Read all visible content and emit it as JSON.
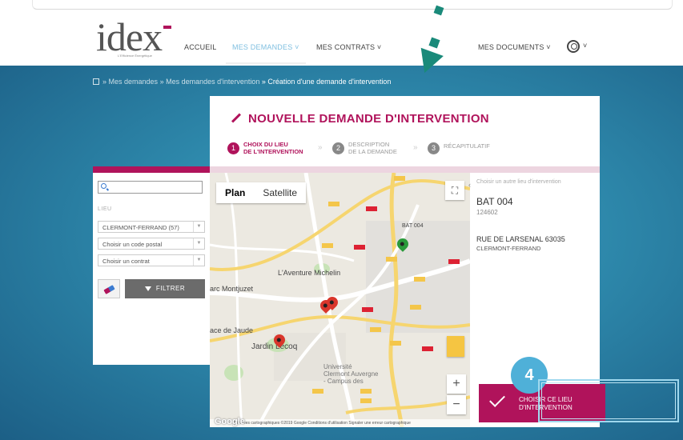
{
  "header": {
    "logo_text": "idex",
    "logo_tagline": "L'Efficience Énergétique",
    "nav": [
      {
        "label": "ACCUEIL"
      },
      {
        "label": "MES DEMANDES ˅"
      },
      {
        "label": "MES CONTRATS ˅"
      },
      {
        "label": "MES DOCUMENTS ˅"
      }
    ],
    "user_caret": "˅"
  },
  "breadcrumb": {
    "items": [
      "» Mes demandes",
      "» Mes demandes d'intervention",
      "» Création d'une demande d'intervention"
    ]
  },
  "page": {
    "title": "NOUVELLE DEMANDE D'INTERVENTION",
    "steps": [
      {
        "num": "1",
        "line1": "CHOIX DU LIEU",
        "line2": "DE L'INTERVENTION"
      },
      {
        "num": "2",
        "line1": "DESCRIPTION",
        "line2": "DE LA DEMANDE"
      },
      {
        "num": "3",
        "line1": "RÉCAPITULATIF",
        "line2": ""
      }
    ],
    "step_sep": "»"
  },
  "filters": {
    "lieu_label": "LIEU",
    "site_value": "CLERMONT-FERRAND (57)",
    "postal_placeholder": "Choisir un code postal",
    "contract_placeholder": "Choisir un contrat",
    "filter_button": "FILTRER"
  },
  "map": {
    "tab_plan": "Plan",
    "tab_satellite": "Satellite",
    "labels": [
      {
        "text": "L'Aventure Michelin"
      },
      {
        "text": "Jardin Lecoq"
      },
      {
        "text": "arc Montjuzet"
      },
      {
        "text": "ace de Jaude"
      },
      {
        "text": "Université Clermont Auvergne - Campus des"
      },
      {
        "text": "BAT 004"
      }
    ],
    "zoom_in": "+",
    "zoom_out": "−",
    "fullscreen": "⛶",
    "footer": "Données cartographiques ©2019 Google   Conditions d'utilisation   Signaler une erreur cartographique",
    "google": "Google"
  },
  "info": {
    "other_place": "Choisir un autre lieu d'intervention",
    "building": "BAT 004",
    "code": "124602",
    "address_line1": "RUE DE LARSENAL 63035",
    "address_line2": "CLERMONT-FERRAND"
  },
  "actions": {
    "choose_line1": "CHOISIR CE LIEU",
    "choose_line2": "D'INTERVENTION"
  },
  "annotation": {
    "step_badge": "4"
  },
  "colors": {
    "brand": "#b0135b",
    "accent": "#4fb0d8",
    "arrow": "#1a8a7a"
  }
}
